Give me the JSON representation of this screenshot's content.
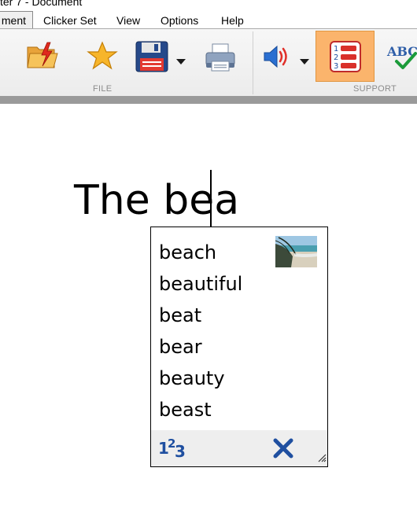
{
  "window": {
    "title": "ter 7 - Document"
  },
  "menu": {
    "active_tab": "ment",
    "items": [
      "Clicker Set",
      "View",
      "Options",
      "Help"
    ]
  },
  "ribbon": {
    "groups": [
      "FILE",
      "SUPPORT"
    ],
    "buttons": [
      {
        "icon": "open-folder-icon"
      },
      {
        "icon": "star-icon"
      },
      {
        "icon": "save-icon",
        "dropdown": true
      },
      {
        "icon": "print-icon"
      },
      {
        "icon": "speaker-icon",
        "dropdown": true
      },
      {
        "icon": "word-predictor-icon",
        "active": true
      },
      {
        "icon": "spellcheck-icon"
      }
    ],
    "accent": "#fbb46c"
  },
  "document": {
    "text": "The bea"
  },
  "prediction": {
    "suggestions": [
      "beach",
      "beautiful",
      "beat",
      "bear",
      "beauty",
      "beast"
    ],
    "footer_icons": [
      "numbers-icon",
      "close-icon"
    ]
  }
}
